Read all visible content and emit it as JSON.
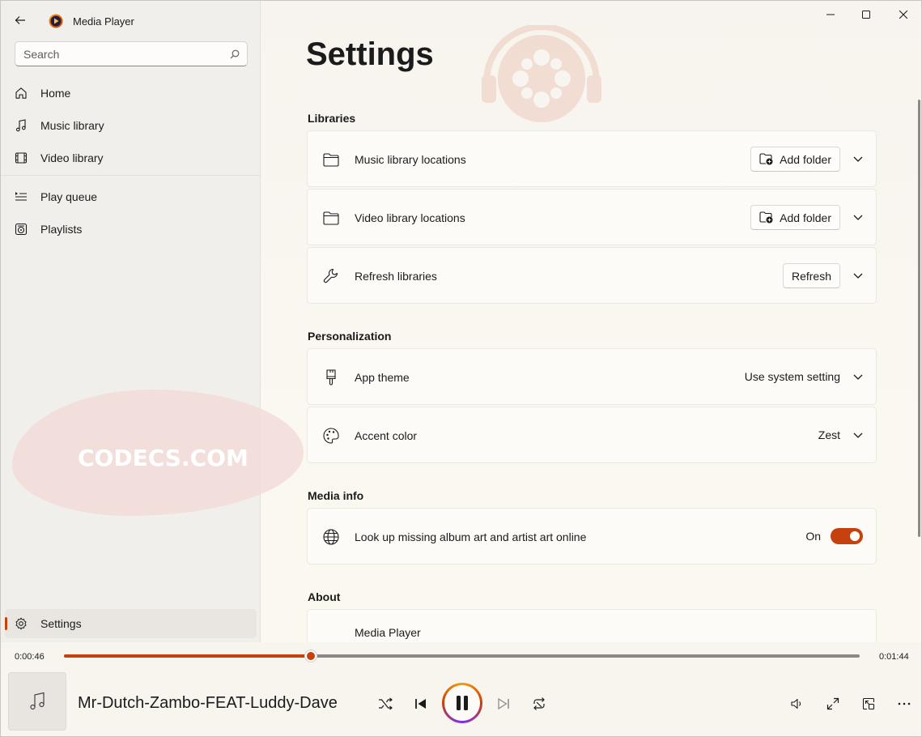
{
  "app": {
    "title": "Media Player"
  },
  "search": {
    "placeholder": "Search"
  },
  "sidebar": {
    "items": [
      {
        "label": "Home",
        "icon": "home-icon"
      },
      {
        "label": "Music library",
        "icon": "music-note-icon"
      },
      {
        "label": "Video library",
        "icon": "film-icon"
      },
      {
        "label": "Play queue",
        "icon": "queue-icon"
      },
      {
        "label": "Playlists",
        "icon": "playlist-icon"
      }
    ],
    "settings_label": "Settings"
  },
  "watermark": {
    "text": "CODECS.COM"
  },
  "page": {
    "title": "Settings"
  },
  "sections": {
    "libraries": {
      "title": "Libraries",
      "music_label": "Music library locations",
      "video_label": "Video library locations",
      "refresh_label": "Refresh libraries",
      "add_folder_label": "Add folder",
      "refresh_button": "Refresh"
    },
    "personalization": {
      "title": "Personalization",
      "theme_label": "App theme",
      "theme_value": "Use system setting",
      "accent_label": "Accent color",
      "accent_value": "Zest"
    },
    "media_info": {
      "title": "Media info",
      "lookup_label": "Look up missing album art and artist art online",
      "lookup_state": "On",
      "lookup_on": true
    },
    "about": {
      "title": "About",
      "partial_label": "Media Player"
    }
  },
  "player": {
    "elapsed": "0:00:46",
    "total": "0:01:44",
    "progress": 0.31,
    "track_title": "Mr-Dutch-Zambo-FEAT-Luddy-Dave"
  },
  "colors": {
    "accent": "#c7410f"
  }
}
